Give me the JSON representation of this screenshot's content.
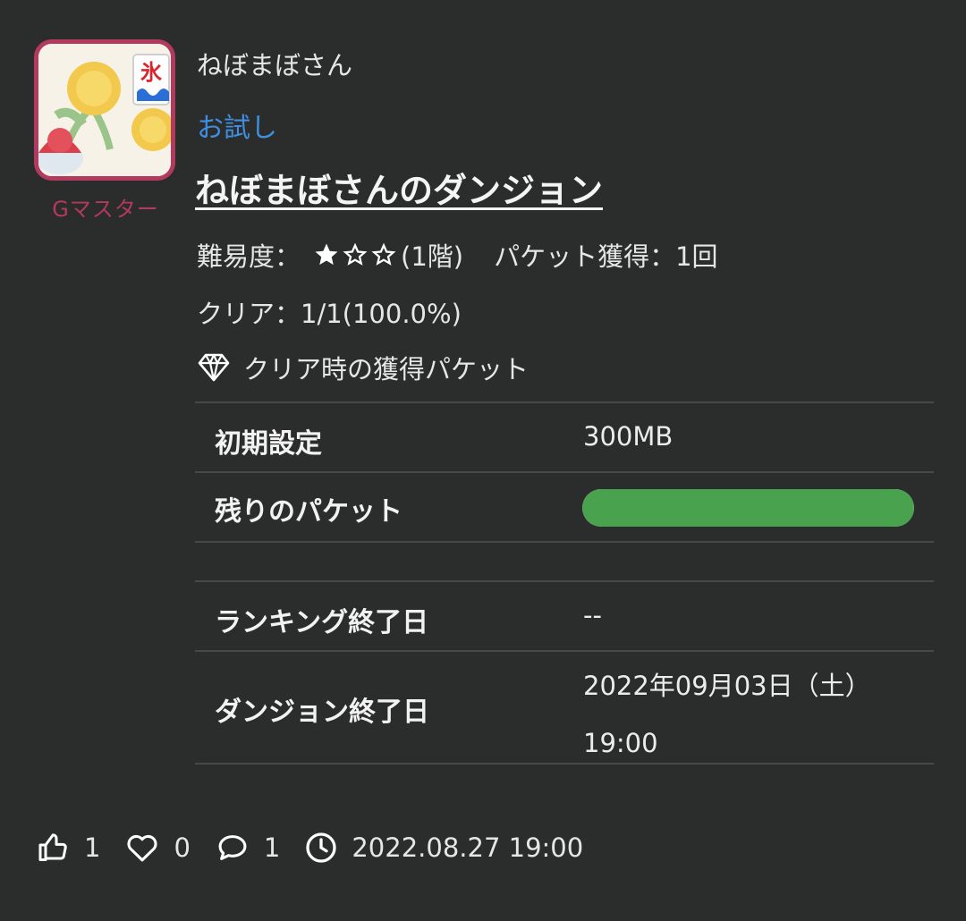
{
  "author": {
    "name": "ねぼまぼさん",
    "rank": "Gマスター",
    "avatar_icon": "shaved-ice-avatar",
    "flag_char": "氷"
  },
  "post": {
    "tag": "お試し",
    "title": "ねぼまぼさんのダンジョン",
    "difficulty_label": "難易度：",
    "difficulty_rating": 1,
    "difficulty_max": 3,
    "difficulty_suffix": "(1階)",
    "packet_gain": "パケット獲得：1回",
    "clear": "クリア：1/1(100.0%)",
    "reward_label": "クリア時の獲得パケット"
  },
  "table": {
    "initial_label": "初期設定",
    "initial_value": "300MB",
    "remaining_label": "残りのパケット",
    "remaining_fraction": 1.0,
    "ranking_end_label": "ランキング終了日",
    "ranking_end_value": "--",
    "dungeon_end_label": "ダンジョン終了日",
    "dungeon_end_date": "2022年09月03日（土）",
    "dungeon_end_time": "19:00"
  },
  "footer": {
    "likes": "1",
    "favorites": "0",
    "comments": "1",
    "posted_at": "2022.08.27 19:00"
  },
  "colors": {
    "accent_tag": "#3f8fe0",
    "rank": "#b23a5e",
    "bar_fill": "#49a24d"
  }
}
